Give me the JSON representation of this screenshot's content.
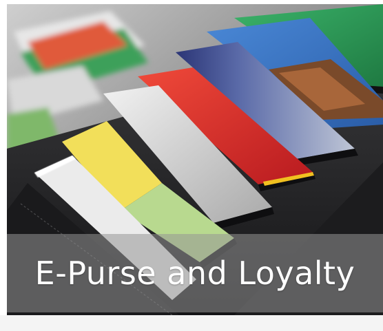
{
  "caption": {
    "text": "E-Purse and Loyalty"
  },
  "photo": {
    "subject": "credit-cards-in-wallet",
    "colors": {
      "wallet": "#1e1e20",
      "card_white": "#e9e9e9",
      "card_yellow": "#f2df5a",
      "card_green_light": "#b8d98f",
      "card_silver": "#cfcfcf",
      "card_red": "#d8282a",
      "card_navy": "#2c3a7a",
      "card_blue": "#3d78c7",
      "card_green": "#2e9c52"
    }
  }
}
